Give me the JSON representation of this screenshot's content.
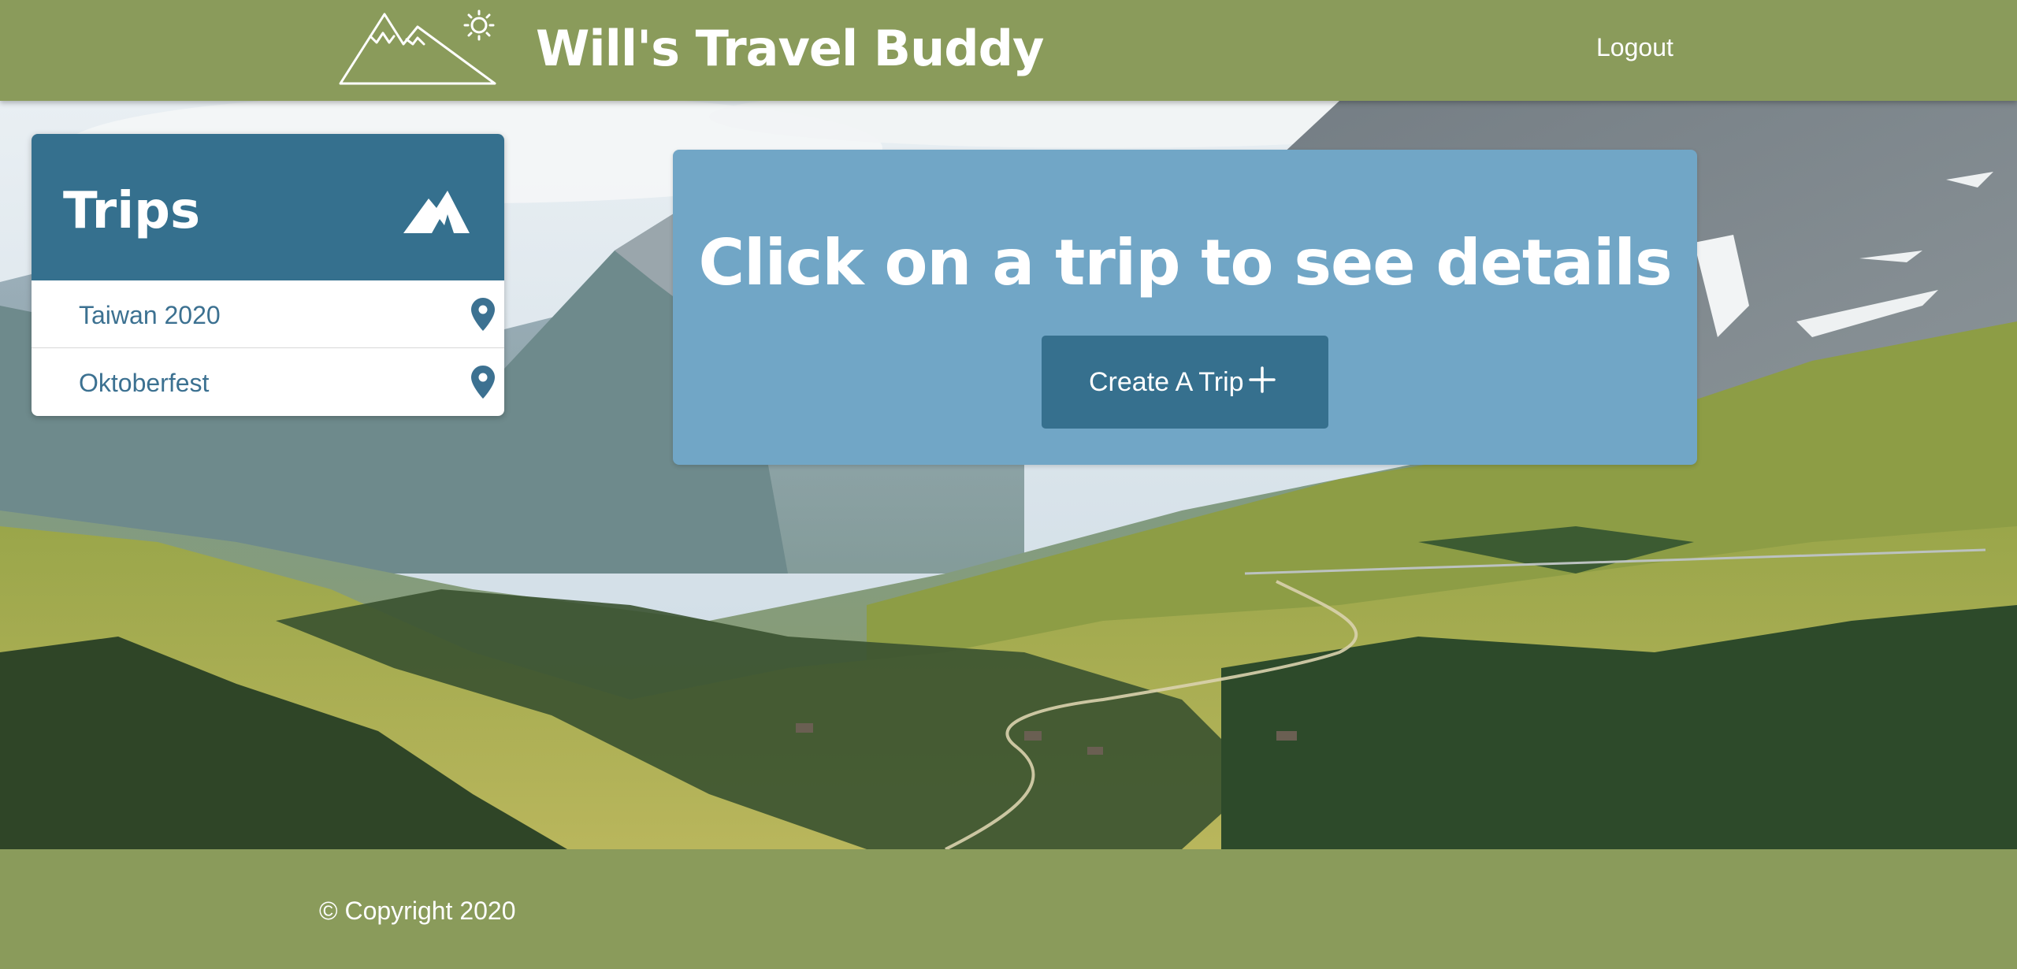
{
  "app": {
    "title": "Will's Travel Buddy",
    "logo_icon": "mountain-sun-icon"
  },
  "header": {
    "logout_label": "Logout"
  },
  "trips_panel": {
    "title": "Trips",
    "header_icon": "mountains-icon",
    "items": [
      {
        "label": "Taiwan 2020",
        "icon": "map-pin-icon"
      },
      {
        "label": "Oktoberfest",
        "icon": "map-pin-icon"
      }
    ]
  },
  "main": {
    "heading": "Click on a trip to see details",
    "create_button_label": "Create A Trip",
    "create_button_icon": "plus-icon"
  },
  "footer": {
    "copyright": "© Copyright 2020"
  },
  "colors": {
    "header_green": "#8a9b5b",
    "panel_blue_dark": "#35708e",
    "card_blue": "#71a6c6",
    "trip_text": "#3c7191"
  }
}
